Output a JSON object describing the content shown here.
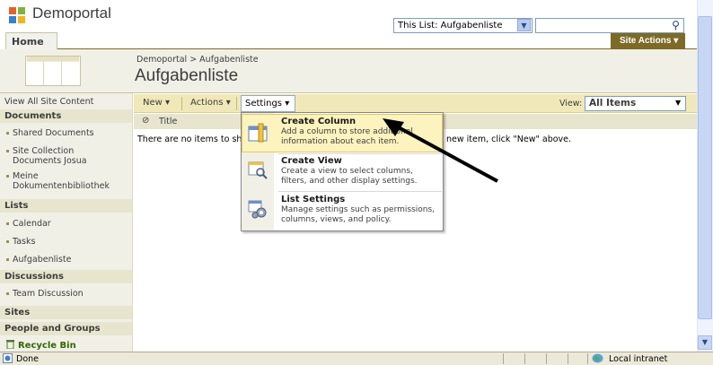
{
  "header": {
    "portal_title": "Demoportal",
    "home_tab": "Home",
    "search_scope": "This List: Aufgabenliste",
    "search_value": "",
    "site_actions": "Site Actions ▾"
  },
  "title_area": {
    "breadcrumb_root": "Demoportal",
    "breadcrumb_sep": " > ",
    "breadcrumb_current": "Aufgabenliste",
    "page_title": "Aufgabenliste"
  },
  "leftnav": {
    "view_all": "View All Site Content",
    "documents_header": "Documents",
    "documents": [
      "Shared Documents",
      "Site Collection Documents Josua",
      "Meine Dokumentenbibliothek"
    ],
    "lists_header": "Lists",
    "lists": [
      "Calendar",
      "Tasks",
      "Aufgabenliste"
    ],
    "discussions_header": "Discussions",
    "discussions": [
      "Team Discussion"
    ],
    "sites_header": "Sites",
    "people_header": "People and Groups",
    "recycle_bin": "Recycle Bin"
  },
  "toolbar": {
    "new": "New ▾",
    "actions": "Actions ▾",
    "settings": "Settings ▾",
    "view_label": "View:",
    "view_value": "All Items",
    "view_arrow": "▼"
  },
  "list": {
    "column_title": "Title",
    "empty_a": "There are no items to show",
    "empty_b": "new item, click \"New\" above."
  },
  "menu": {
    "items": [
      {
        "title": "Create Column",
        "desc": "Add a column to store additional information about each item."
      },
      {
        "title": "Create View",
        "desc": "Create a view to select columns, filters, and other display settings."
      },
      {
        "title": "List Settings",
        "desc": "Manage settings such as permissions, columns, views, and policy."
      }
    ]
  },
  "statusbar": {
    "status": "Done",
    "zone": "Local intranet"
  },
  "icons": {
    "logo": "flower-logo-icon",
    "search": "magnifier-icon",
    "attach": "paperclip-icon",
    "create_column": "column-icon",
    "create_view": "view-icon",
    "list_settings": "settings-gear-icon",
    "page": "ie-page-icon",
    "zone": "intranet-globe-icon"
  },
  "colors": {
    "brand_brown": "#7c6b27",
    "toolbar": "#f1e8b9",
    "nav_bg": "#f1f0e7",
    "highlight": "#fdf3be"
  }
}
